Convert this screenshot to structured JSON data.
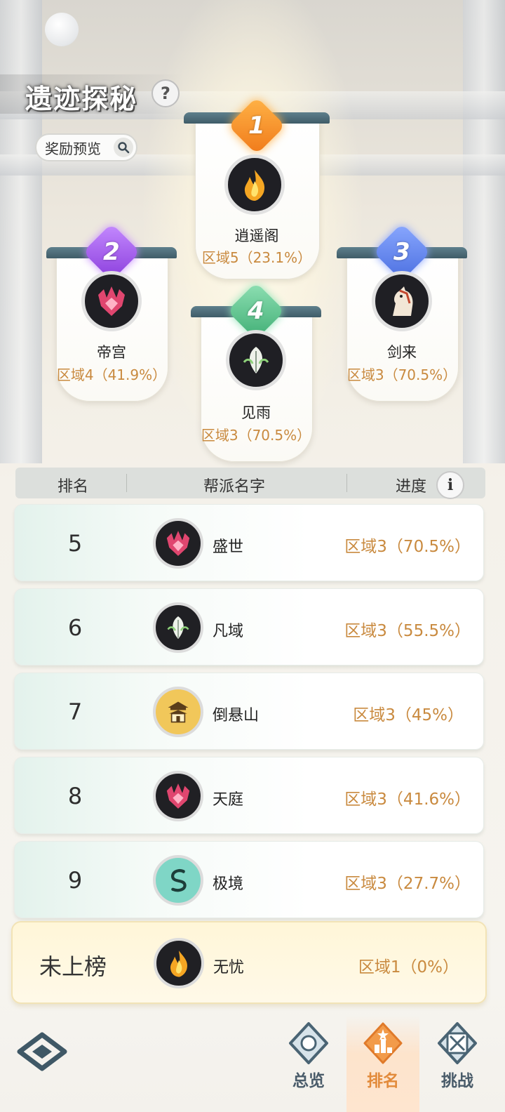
{
  "header": {
    "title": "遗迹探秘",
    "help_icon_text": "?",
    "reward_preview_label": "奖励预览"
  },
  "podium": [
    {
      "rank": "1",
      "name": "逍遥阁",
      "progress": "区域5（23.1%）",
      "emblem": "flame-emblem-icon",
      "medal_color": "#f28c2a"
    },
    {
      "rank": "2",
      "name": "帝宫",
      "progress": "区域4（41.9%）",
      "emblem": "crown-flame-emblem-icon",
      "medal_color": "#a05adf"
    },
    {
      "rank": "3",
      "name": "剑来",
      "progress": "区域3（70.5%）",
      "emblem": "horse-emblem-icon",
      "medal_color": "#5a7de8"
    },
    {
      "rank": "4",
      "name": "见雨",
      "progress": "区域3（70.5%）",
      "emblem": "leaf-emblem-icon",
      "medal_color": "#57c48d"
    }
  ],
  "table": {
    "headers": {
      "rank": "排名",
      "guild_name": "帮派名字",
      "progress": "进度"
    },
    "info_icon_text": "i",
    "rows": [
      {
        "rank": "5",
        "name": "盛世",
        "progress": "区域3（70.5%）",
        "emblem": "crown-flame-emblem-icon"
      },
      {
        "rank": "6",
        "name": "凡域",
        "progress": "区域3（55.5%）",
        "emblem": "leaf-emblem-icon"
      },
      {
        "rank": "7",
        "name": "倒悬山",
        "progress": "区域3（45%）",
        "emblem": "pavilion-emblem-icon"
      },
      {
        "rank": "8",
        "name": "天庭",
        "progress": "区域3（41.6%）",
        "emblem": "crown-flame-emblem-icon"
      },
      {
        "rank": "9",
        "name": "极境",
        "progress": "区域3（27.7%）",
        "emblem": "serpent-emblem-icon"
      }
    ],
    "my_guild": {
      "rank": "未上榜",
      "name": "无忧",
      "progress": "区域1（0%）",
      "emblem": "flame-emblem-icon"
    }
  },
  "nav": {
    "items": [
      {
        "label": "总览",
        "icon": "overview-icon",
        "active": false
      },
      {
        "label": "排名",
        "icon": "ranking-icon",
        "active": true
      },
      {
        "label": "挑战",
        "icon": "challenge-icon",
        "active": false
      }
    ],
    "logo_icon": "diamond-logo-icon"
  },
  "colors": {
    "progress_text": "#c98a3f",
    "active_tab": "#e28a3a",
    "nav_text": "#4a5c6a"
  }
}
